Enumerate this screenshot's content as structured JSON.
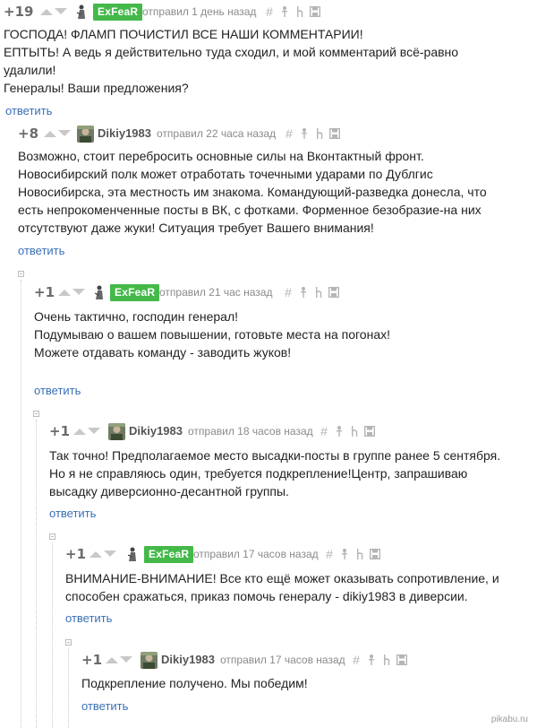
{
  "icon_names": [
    "arrow-up-icon",
    "arrow-down-icon",
    "hash-icon",
    "pin-icon",
    "tree-icon",
    "save-icon"
  ],
  "colors": {
    "badge": "#44b94a",
    "reply_link": "#3a6fb6",
    "rating": "#6b6b6b",
    "meta": "#8a8a8a"
  },
  "comments": [
    {
      "rating": "+19",
      "user": "ExFeaR",
      "meta": "отправил 1 день назад",
      "lines": [
        "ГОСПОДА! ФЛАМП ПОЧИСТИЛ ВСЕ НАШИ КОММЕНТАРИИ!",
        "ЕПТЫТЬ! А ведь я действительно туда сходил, и мой комментарий всё-равно",
        "удалили!",
        "Генералы! Ваши предложения?"
      ],
      "reply": "ответить"
    },
    {
      "rating": "+8",
      "user": "Dikiy1983",
      "meta": "отправил 22 часа назад",
      "lines": [
        "Возможно, стоит перебросить основные силы на Вконтактный фронт.",
        "Новосибирский полк может отработать точечными ударами по Дублгис",
        "Новосибирска, эта местность им знакома. Командующий-разведка донесла, что",
        "есть непрокоменченные посты в ВК, с фотками. Форменное безобразие-на них",
        "отсутствуют даже жуки! Ситуация требует Вашего внимания!"
      ],
      "reply": "ответить"
    },
    {
      "rating": "+1",
      "user": "ExFeaR",
      "meta": "отправил 21 час назад",
      "lines": [
        "Очень тактично, господин генерал!",
        "Подумываю о вашем повышении, готовьте места на погонах!",
        "Можете отдавать команду - заводить жуков!"
      ],
      "reply": "ответить"
    },
    {
      "rating": "+1",
      "user": "Dikiy1983",
      "meta": "отправил 18 часов назад",
      "lines": [
        "Так точно! Предполагаемое место высадки-посты в группе ранее 5 сентября.",
        "Но я не справляюсь один, требуется подкрепление!Центр, запрашиваю",
        "высадку диверсионно-десантной группы."
      ],
      "reply": "ответить"
    },
    {
      "rating": "+1",
      "user": "ExFeaR",
      "meta": "отправил 17 часов назад",
      "lines": [
        "ВНИМАНИЕ-ВНИМАНИЕ! Все кто ещё может оказывать сопротивление, и",
        "способен сражаться, приказ помочь генералу - dikiy1983 в диверсии."
      ],
      "reply": "ответить"
    },
    {
      "rating": "+1",
      "user": "Dikiy1983",
      "meta": "отправил 17 часов назад",
      "lines": [
        "Подкрепление получено. Мы победим!"
      ],
      "reply": "ответить"
    }
  ],
  "watermark": "pikabu.ru"
}
